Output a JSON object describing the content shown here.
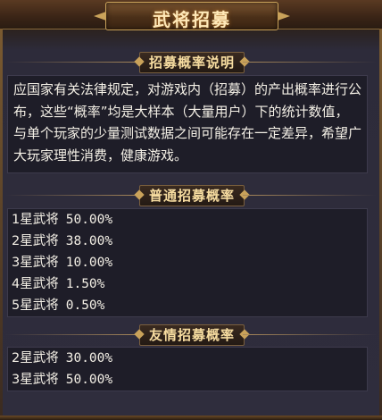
{
  "window": {
    "title": "武将招募"
  },
  "sections": {
    "description": {
      "header": "招募概率说明",
      "body": "应国家有关法律规定，对游戏内（招募）的产出概率进行公布，这些“概率”均是大样本（大量用户）下的统计数值，与单个玩家的少量测试数据之间可能存在一定差异，希望广大玩家理性消费，健康游戏。"
    },
    "normal": {
      "header": "普通招募概率",
      "rows": [
        {
          "label": "1星武将",
          "rate": "50.00%"
        },
        {
          "label": "2星武将",
          "rate": "38.00%"
        },
        {
          "label": "3星武将",
          "rate": "10.00%"
        },
        {
          "label": "4星武将",
          "rate": "1.50%"
        },
        {
          "label": "5星武将",
          "rate": "0.50%"
        }
      ]
    },
    "friendship": {
      "header": "友情招募概率",
      "rows": [
        {
          "label": "2星武将",
          "rate": "30.00%"
        },
        {
          "label": "3星武将",
          "rate": "50.00%"
        }
      ]
    }
  }
}
